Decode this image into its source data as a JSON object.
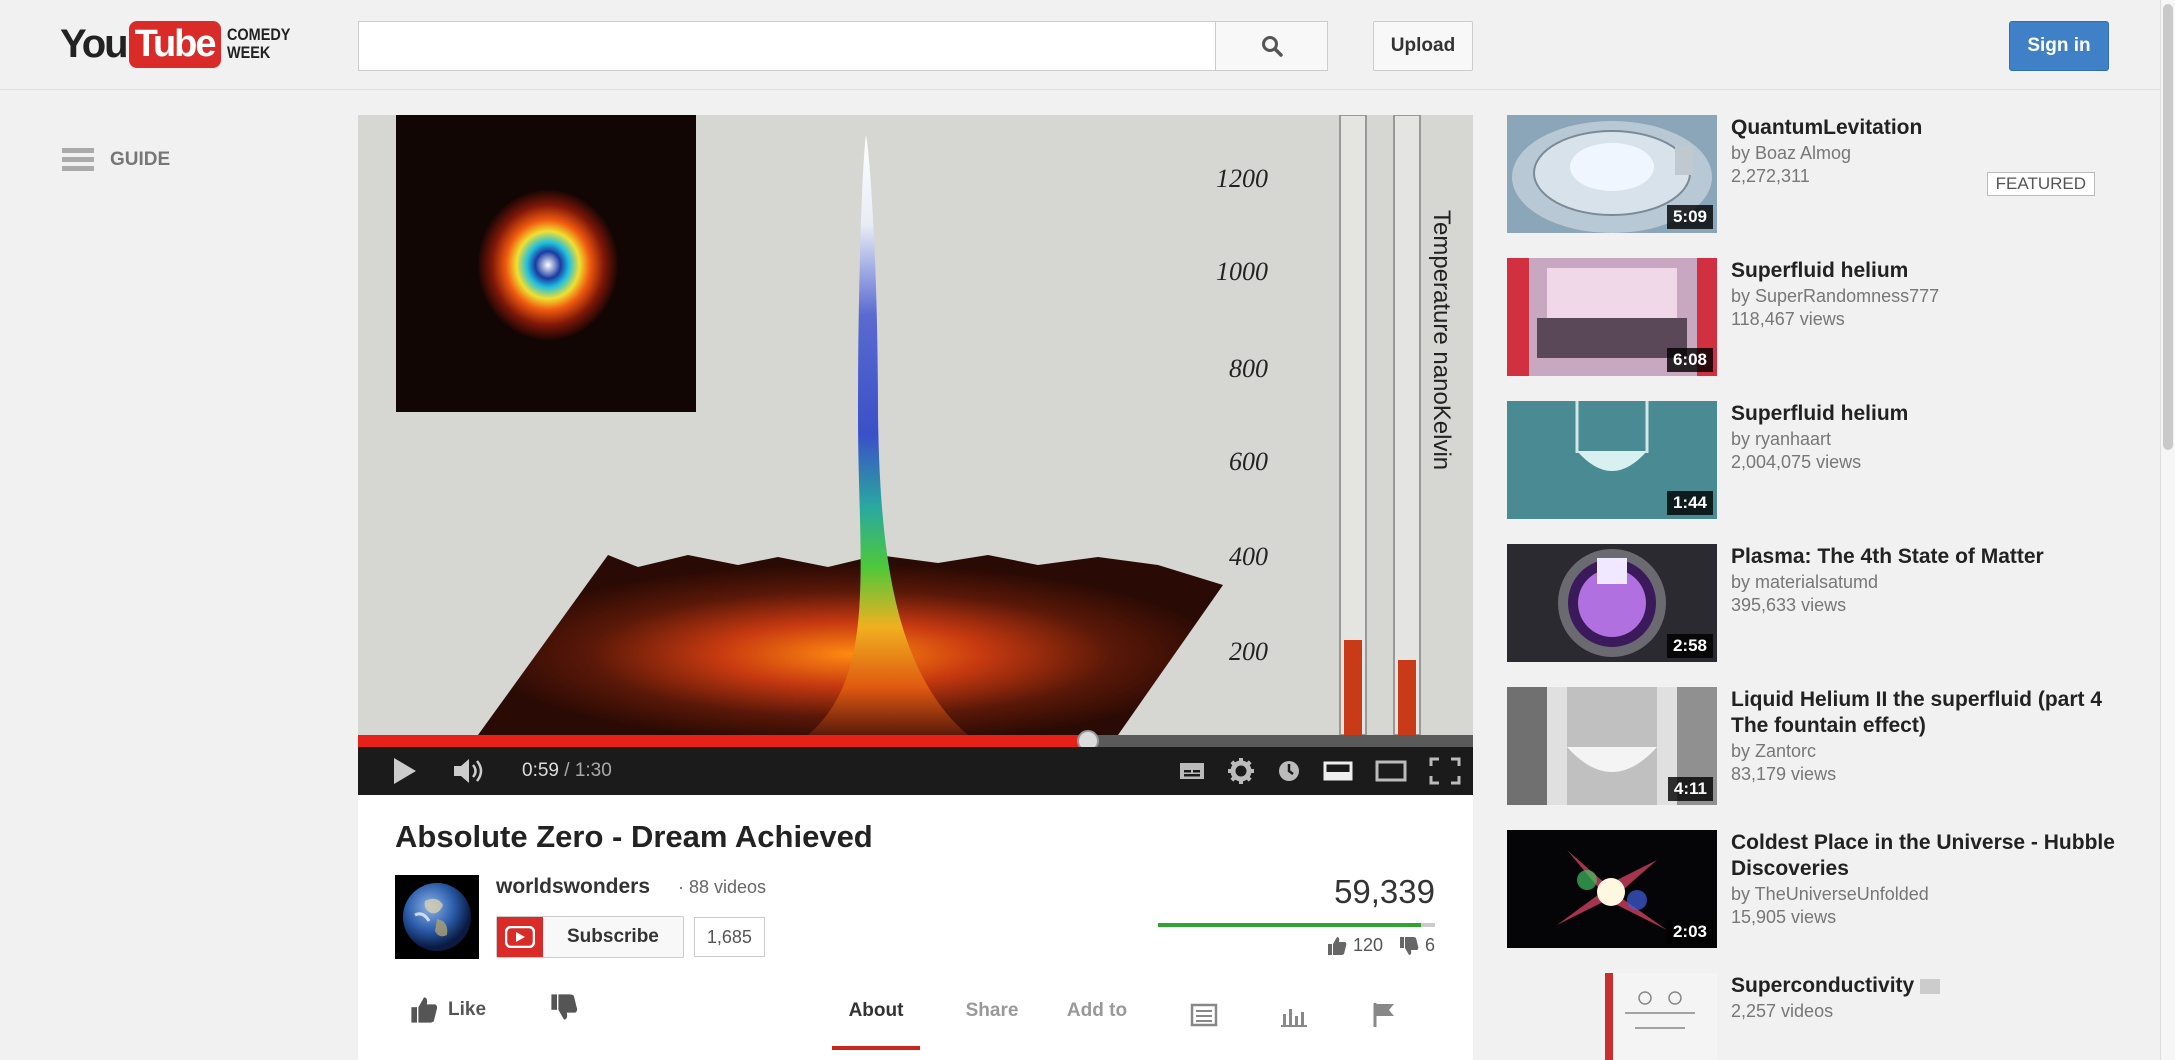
{
  "header": {
    "logo_you": "You",
    "logo_tube": "Tube",
    "logo_sub_line1": "COMEDY",
    "logo_sub_line2": "WEEK",
    "search_placeholder": "",
    "upload_label": "Upload",
    "signin_label": "Sign in"
  },
  "guide": {
    "label": "GUIDE"
  },
  "player": {
    "current_time": "0:59",
    "duration": "1:30",
    "progress_fraction": 0.655,
    "overlay_scale": [
      "1200",
      "1000",
      "800",
      "600",
      "400",
      "200"
    ],
    "overlay_label": "Temperature nanoKelvin"
  },
  "video": {
    "title": "Absolute Zero - Dream Achieved",
    "channel": "worldswonders",
    "video_count": "88 videos",
    "subscribe_label": "Subscribe",
    "subscriber_count": "1,685",
    "views": "59,339",
    "likes": "120",
    "dislikes": "6",
    "like_fraction": 0.95,
    "like_label": "Like"
  },
  "tabs": [
    {
      "label": "About",
      "active": true
    },
    {
      "label": "Share",
      "active": false
    },
    {
      "label": "Add to",
      "active": false
    }
  ],
  "sidebar": [
    {
      "title": "QuantumLevitation",
      "by": "by Boaz Almog",
      "views": "2,272,311",
      "duration": "5:09",
      "badge": "FEATURED"
    },
    {
      "title": "Superfluid helium",
      "by": "by SuperRandomness777",
      "views": "118,467 views",
      "duration": "6:08"
    },
    {
      "title": "Superfluid helium",
      "by": "by ryanhaart",
      "views": "2,004,075 views",
      "duration": "1:44"
    },
    {
      "title": "Plasma: The 4th State of Matter",
      "by": "by materialsatumd",
      "views": "395,633 views",
      "duration": "2:58"
    },
    {
      "title": "Liquid Helium II the superfluid (part 4 The fountain effect)",
      "by": "by Zantorc",
      "views": "83,179 views",
      "duration": "4:11"
    },
    {
      "title": "Coldest Place in the Universe - Hubble Discoveries",
      "by": "by TheUniverseUnfolded",
      "views": "15,905 views",
      "duration": "2:03"
    },
    {
      "title": "Superconductivity",
      "by": "2,257 videos",
      "views": "",
      "duration": ""
    }
  ]
}
